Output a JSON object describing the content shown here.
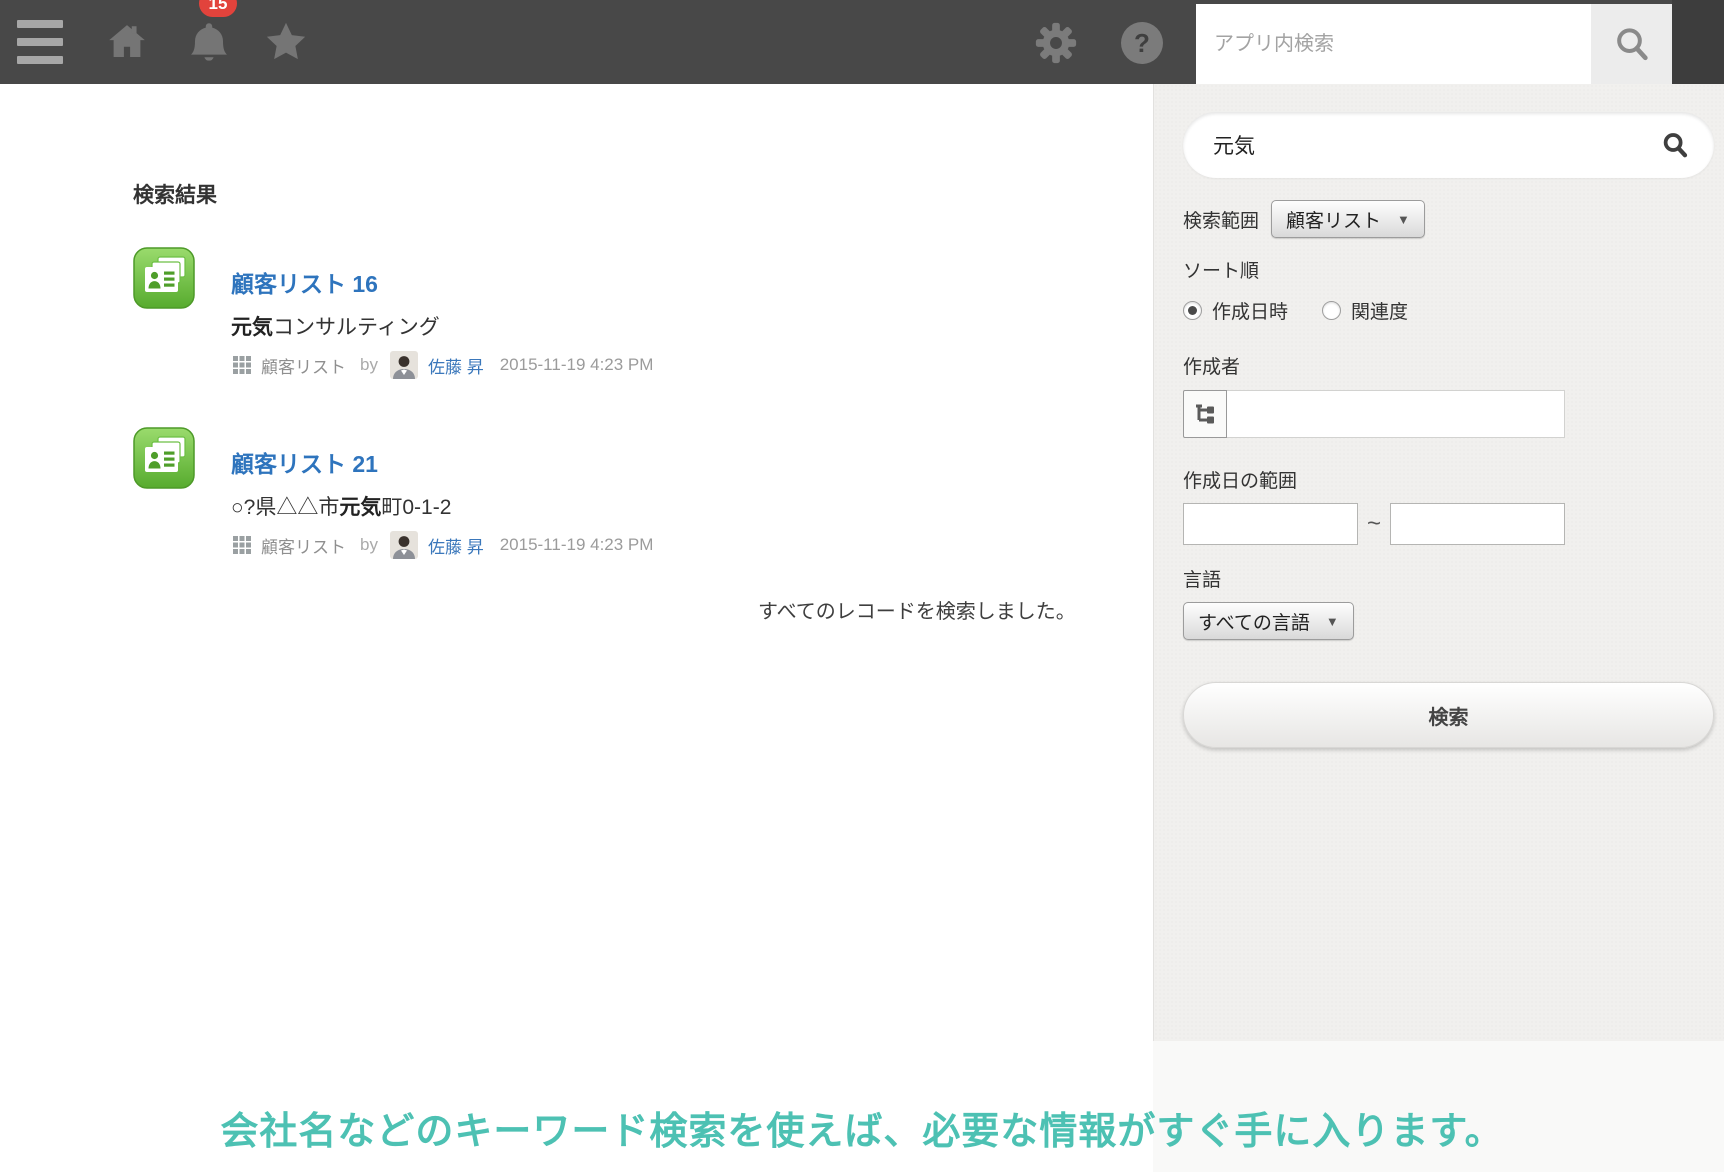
{
  "topbar": {
    "notification_count": "15",
    "search_placeholder": "アプリ内検索",
    "help_glyph": "?"
  },
  "main": {
    "heading": "検索結果",
    "results": [
      {
        "title": "顧客リスト 16",
        "subtitle_prefix": "",
        "subtitle_highlight": "元気",
        "subtitle_rest": "コンサルティング",
        "app_name": "顧客リスト",
        "by_label": "by",
        "user": "佐藤 昇",
        "timestamp": "2015-11-19 4:23 PM"
      },
      {
        "title": "顧客リスト 21",
        "subtitle_prefix": "○?県△△市",
        "subtitle_highlight": "元気",
        "subtitle_rest": "町0-1-2",
        "app_name": "顧客リスト",
        "by_label": "by",
        "user": "佐藤 昇",
        "timestamp": "2015-11-19 4:23 PM"
      }
    ],
    "notice": "すべてのレコードを検索しました。"
  },
  "sidebar": {
    "query": "元気",
    "scope_label": "検索範囲",
    "scope_value": "顧客リスト",
    "dropdown_caret": "▼",
    "sort_label": "ソート順",
    "sort_options": [
      {
        "label": "作成日時",
        "selected": true
      },
      {
        "label": "関連度",
        "selected": false
      }
    ],
    "creator_label": "作成者",
    "creator_value": "",
    "range_label": "作成日の範囲",
    "range_from": "",
    "range_separator": "~",
    "range_to": "",
    "language_label": "言語",
    "language_value": "すべての言語",
    "search_button_label": "検索"
  },
  "caption": "会社名などのキーワード検索を使えば、必要な情報がすぐ手に入ります。",
  "colors": {
    "topbar_bg": "#484848",
    "badge_red": "#e2433c",
    "link_blue": "#2e74bd",
    "user_link_blue": "#3a77bb",
    "app_icon_green": "#57ab2e",
    "sidebar_bg": "#f1f0ee",
    "caption_teal": "#4dc1b3"
  }
}
